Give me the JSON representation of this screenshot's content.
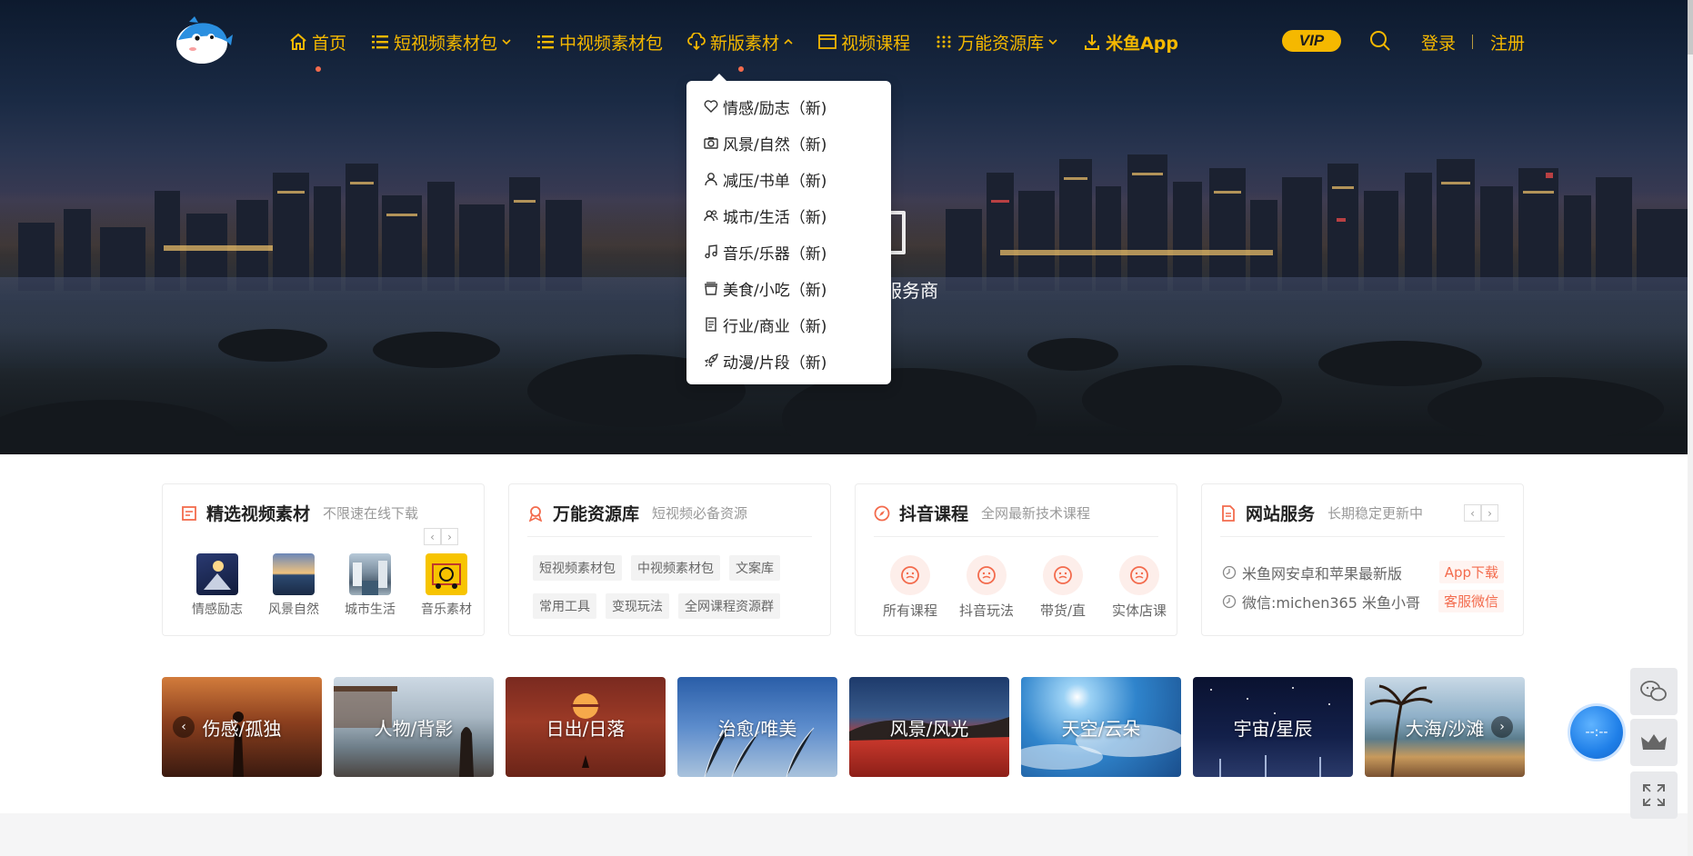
{
  "hero": {
    "subtitle_fragment": "服务商"
  },
  "nav": {
    "items": [
      {
        "label": "首页",
        "icon": "home-icon"
      },
      {
        "label": "短视频素材包",
        "icon": "list-icon"
      },
      {
        "label": "中视频素材包",
        "icon": "list-icon"
      },
      {
        "label": "新版素材",
        "icon": "cloud-download-icon"
      },
      {
        "label": "视频课程",
        "icon": "window-icon"
      },
      {
        "label": "万能资源库",
        "icon": "grid-dots-icon"
      },
      {
        "label": "米鱼App",
        "icon": "download-icon"
      }
    ],
    "vip": "VIP",
    "login": "登录",
    "register": "注册"
  },
  "dropdown": {
    "items": [
      {
        "label": "情感/励志（新)",
        "icon": "heart-icon"
      },
      {
        "label": "风景/自然（新)",
        "icon": "camera-icon"
      },
      {
        "label": "减压/书单（新)",
        "icon": "user-icon"
      },
      {
        "label": "城市/生活（新)",
        "icon": "users-icon"
      },
      {
        "label": "音乐/乐器（新)",
        "icon": "music-icon"
      },
      {
        "label": "美食/小吃（新)",
        "icon": "basket-icon"
      },
      {
        "label": "行业/商业（新)",
        "icon": "document-icon"
      },
      {
        "label": "动漫/片段（新)",
        "icon": "rocket-icon"
      }
    ]
  },
  "cards": {
    "featured": {
      "title": "精选视频素材",
      "subtitle": "不限速在线下载",
      "items": [
        "情感励志",
        "风景自然",
        "城市生活",
        "音乐素材"
      ]
    },
    "library": {
      "title": "万能资源库",
      "subtitle": "短视频必备资源",
      "tags": [
        "短视频素材包",
        "中视频素材包",
        "文案库",
        "常用工具",
        "变现玩法",
        "全网课程资源群"
      ]
    },
    "douyin": {
      "title": "抖音课程",
      "subtitle": "全网最新技术课程",
      "items": [
        "所有课程",
        "抖音玩法",
        "带货/直",
        "实体店课"
      ]
    },
    "service": {
      "title": "网站服务",
      "subtitle": "长期稳定更新中",
      "rows": [
        {
          "text": "米鱼网安卓和苹果最新版",
          "action": "App下载"
        },
        {
          "text": "微信:michen365 米鱼小哥",
          "action": "客服微信"
        }
      ]
    }
  },
  "strip": {
    "tiles": [
      "伤感/孤独",
      "人物/背影",
      "日出/日落",
      "治愈/唯美",
      "风景/风光",
      "天空/云朵",
      "宇宙/星辰",
      "大海/沙滩"
    ]
  },
  "floating": {
    "timer": "--:--"
  },
  "colors": {
    "accent": "#f5b800",
    "highlight": "#f36b4d"
  }
}
